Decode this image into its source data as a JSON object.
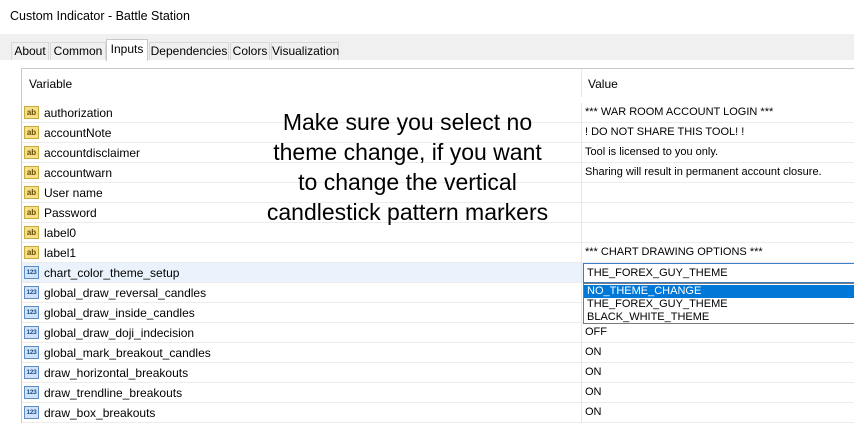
{
  "window": {
    "title": "Custom Indicator - Battle Station"
  },
  "tabs": [
    {
      "label": "About"
    },
    {
      "label": "Common"
    },
    {
      "label": "Inputs"
    },
    {
      "label": "Dependencies"
    },
    {
      "label": "Colors"
    },
    {
      "label": "Visualization"
    }
  ],
  "active_tab": "Inputs",
  "grid": {
    "headers": {
      "variable": "Variable",
      "value": "Value"
    },
    "rows": [
      {
        "icon": "ab",
        "name": "authorization",
        "value": "*** WAR ROOM ACCOUNT LOGIN ***"
      },
      {
        "icon": "ab",
        "name": "accountNote",
        "value": "! DO NOT SHARE THIS TOOL! !"
      },
      {
        "icon": "ab",
        "name": "accountdisclaimer",
        "value": "Tool is licensed to you only."
      },
      {
        "icon": "ab",
        "name": "accountwarn",
        "value": "Sharing will result in permanent account closure."
      },
      {
        "icon": "ab",
        "name": "User name",
        "value": ""
      },
      {
        "icon": "ab",
        "name": "Password",
        "value": ""
      },
      {
        "icon": "ab",
        "name": "label0",
        "value": ""
      },
      {
        "icon": "ab",
        "name": "label1",
        "value": "*** CHART DRAWING OPTIONS ***"
      },
      {
        "icon": "123",
        "name": "chart_color_theme_setup",
        "value": ""
      },
      {
        "icon": "123",
        "name": "global_draw_reversal_candles",
        "value": ""
      },
      {
        "icon": "123",
        "name": "global_draw_inside_candles",
        "value": ""
      },
      {
        "icon": "123",
        "name": "global_draw_doji_indecision",
        "value": "OFF"
      },
      {
        "icon": "123",
        "name": "global_mark_breakout_candles",
        "value": "ON"
      },
      {
        "icon": "123",
        "name": "draw_horizontal_breakouts",
        "value": "ON"
      },
      {
        "icon": "123",
        "name": "draw_trendline_breakouts",
        "value": "ON"
      },
      {
        "icon": "123",
        "name": "draw_box_breakouts",
        "value": "ON"
      },
      {
        "icon": "123",
        "name": "",
        "value": ""
      }
    ]
  },
  "theme_dropdown": {
    "selected": "THE_FOREX_GUY_THEME",
    "options": [
      "NO_THEME_CHANGE",
      "THE_FOREX_GUY_THEME",
      "BLACK_WHITE_THEME"
    ],
    "highlighted": "NO_THEME_CHANGE"
  },
  "annotation": {
    "lines": [
      "Make sure you select no",
      "theme change, if you want",
      "to change the vertical",
      "candlestick pattern markers"
    ]
  }
}
